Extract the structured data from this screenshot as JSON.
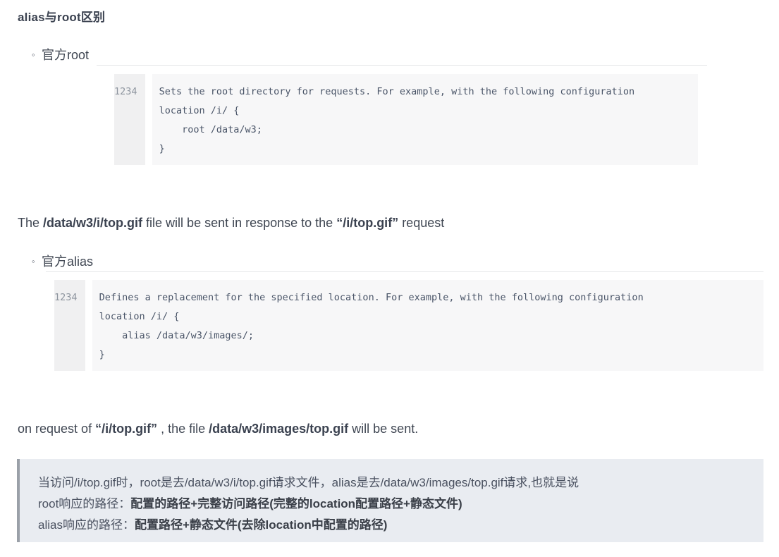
{
  "document": {
    "title": "alias与root区别"
  },
  "sections": [
    {
      "bullet_icon": "hollow-circle-bullet",
      "heading": "官方root",
      "code": {
        "line_numbers": [
          "1",
          "2",
          "3",
          "4"
        ],
        "lines": [
          "Sets the root directory for requests. For example, with the following configuration",
          "location /i/ {",
          "    root /data/w3;",
          "}"
        ]
      }
    },
    {
      "bullet_icon": "hollow-circle-bullet",
      "heading": "官方alias",
      "code": {
        "line_numbers": [
          "1",
          "2",
          "3",
          "4"
        ],
        "lines": [
          "Defines a replacement for the specified location. For example, with the following configuration",
          "location /i/ {",
          "    alias /data/w3/images/;",
          "}"
        ]
      }
    }
  ],
  "paragraphs": {
    "root_result": {
      "prefix": "The ",
      "path": "/data/w3/i/top.gif",
      "middle": " file will be sent in response to the  ",
      "request": "“/i/top.gif”",
      "suffix": "  request"
    },
    "alias_result": {
      "prefix": "on request of  ",
      "request": "“/i/top.gif”",
      "middle": " , the file ",
      "path": "/data/w3/images/top.gif",
      "suffix": " will be sent."
    }
  },
  "callout": {
    "accent_color": "#9aa0a8",
    "background_color": "#e9ecf1",
    "line1": "当访问/i/top.gif时，root是去/data/w3/i/top.gif请求文件，alias是去/data/w3/images/top.gif请求,也就是说",
    "line2_label": "root响应的路径：",
    "line2_value": "配置的路径+完整访问路径(完整的location配置路径+静态文件)",
    "line3_label": "alias响应的路径：",
    "line3_value": "配置路径+静态文件(去除location中配置的路径)"
  }
}
